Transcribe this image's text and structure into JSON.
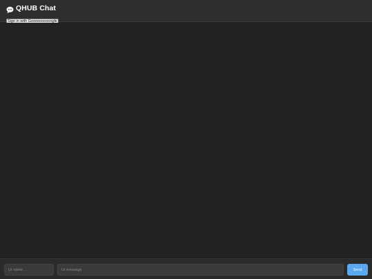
{
  "header": {
    "icon": "speech-bubble-icon",
    "title": "QHUB Chat",
    "signin_label": "Sign in with Goooooooooogle"
  },
  "footer": {
    "name_placeholder": "Ur name ...",
    "message_placeholder": "Ur message",
    "send_label": "Send"
  },
  "colors": {
    "background": "#222222",
    "header": "#2e2e2e",
    "send_button": "#5aa8f0"
  }
}
